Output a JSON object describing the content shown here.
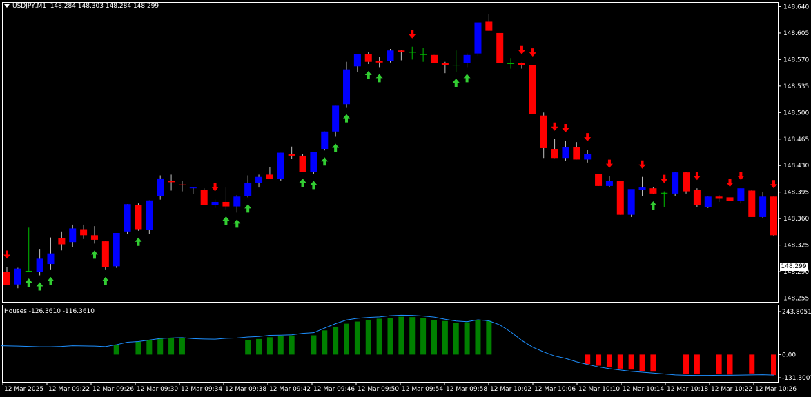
{
  "header": {
    "symbol_label": "USDJPY,M1",
    "ohlc": "148.284 148.303 148.284 148.299"
  },
  "indicator": {
    "label": "Houses -126.3610 -116.3610",
    "axis_labels": [
      "243.8051",
      "0.00",
      "-131.3007"
    ]
  },
  "current_price_label": "148.299",
  "price_axis_labels": [
    "148.640",
    "148.605",
    "148.570",
    "148.535",
    "148.500",
    "148.465",
    "148.430",
    "148.395",
    "148.360",
    "148.325",
    "148.290",
    "148.255"
  ],
  "time_axis_labels": [
    "12 Mar 2025",
    "12 Mar 09:22",
    "12 Mar 09:26",
    "12 Mar 09:30",
    "12 Mar 09:34",
    "12 Mar 09:38",
    "12 Mar 09:42",
    "12 Mar 09:46",
    "12 Mar 09:50",
    "12 Mar 09:54",
    "12 Mar 09:58",
    "12 Mar 10:02",
    "12 Mar 10:06",
    "12 Mar 10:10",
    "12 Mar 10:14",
    "12 Mar 10:18",
    "12 Mar 10:22",
    "12 Mar 10:26"
  ],
  "colors": {
    "background": "#000000",
    "bull_candle": "#0000ff",
    "bear_candle": "#ff0000",
    "doji": "#00c000",
    "wick": "#c0c0c0",
    "up_arrow": "#32cd32",
    "down_arrow": "#ff0000",
    "hist_positive": "#008000",
    "hist_negative": "#ff0000",
    "indicator_line": "#1e90ff",
    "zero_line": "#2f4f4f"
  },
  "chart_data": [
    {
      "type": "candlestick",
      "title": "USDJPY,M1",
      "ylim": [
        148.25,
        148.645
      ],
      "ohlc": [
        [
          148.29,
          148.296,
          148.272,
          148.272
        ],
        [
          148.273,
          148.295,
          148.268,
          148.294
        ],
        [
          148.291,
          148.348,
          148.29,
          148.291
        ],
        [
          148.29,
          148.32,
          148.285,
          148.307
        ],
        [
          148.3,
          148.335,
          148.292,
          148.314
        ],
        [
          148.334,
          148.343,
          148.318,
          148.326
        ],
        [
          148.329,
          148.352,
          148.322,
          148.347
        ],
        [
          148.346,
          148.352,
          148.333,
          148.338
        ],
        [
          148.338,
          148.35,
          148.327,
          148.332
        ],
        [
          148.33,
          148.33,
          148.292,
          148.296
        ],
        [
          148.297,
          148.341,
          148.295,
          148.341
        ],
        [
          148.343,
          148.379,
          148.34,
          148.379
        ],
        [
          148.378,
          148.38,
          148.344,
          148.346
        ],
        [
          148.345,
          148.384,
          148.34,
          148.384
        ],
        [
          148.39,
          148.417,
          148.385,
          148.413
        ],
        [
          148.41,
          148.418,
          148.397,
          148.408
        ],
        [
          148.405,
          148.41,
          148.396,
          148.404
        ],
        [
          148.4,
          148.402,
          148.392,
          148.401
        ],
        [
          148.398,
          148.4,
          148.378,
          148.378
        ],
        [
          148.378,
          148.385,
          148.374,
          148.382
        ],
        [
          148.382,
          148.401,
          148.372,
          148.376
        ],
        [
          148.376,
          148.391,
          148.368,
          148.389
        ],
        [
          148.39,
          148.417,
          148.388,
          148.407
        ],
        [
          148.407,
          148.418,
          148.401,
          148.415
        ],
        [
          148.418,
          148.428,
          148.412,
          148.412
        ],
        [
          148.412,
          148.447,
          148.41,
          148.447
        ],
        [
          148.445,
          148.455,
          148.439,
          148.443
        ],
        [
          148.443,
          148.445,
          148.422,
          148.422
        ],
        [
          148.422,
          148.448,
          148.419,
          148.448
        ],
        [
          148.452,
          148.475,
          148.45,
          148.475
        ],
        [
          148.475,
          148.509,
          148.468,
          148.509
        ],
        [
          148.511,
          148.567,
          148.507,
          148.557
        ],
        [
          148.561,
          148.577,
          148.554,
          148.577
        ],
        [
          148.577,
          148.58,
          148.564,
          148.567
        ],
        [
          148.568,
          148.574,
          148.56,
          148.566
        ],
        [
          148.568,
          148.584,
          148.566,
          148.582
        ],
        [
          148.582,
          148.583,
          148.569,
          148.58
        ],
        [
          148.58,
          148.587,
          148.57,
          148.58
        ],
        [
          148.577,
          148.585,
          148.567,
          148.577
        ],
        [
          148.576,
          148.576,
          148.565,
          148.565
        ],
        [
          148.565,
          148.567,
          148.552,
          148.563
        ],
        [
          148.563,
          148.582,
          148.554,
          148.563
        ],
        [
          148.565,
          148.578,
          148.56,
          148.576
        ],
        [
          148.578,
          148.619,
          148.575,
          148.619
        ],
        [
          148.62,
          148.63,
          148.608,
          148.608
        ],
        [
          148.605,
          148.605,
          148.565,
          148.565
        ],
        [
          148.565,
          148.572,
          148.558,
          148.565
        ],
        [
          148.565,
          148.566,
          148.558,
          148.563
        ],
        [
          148.563,
          148.563,
          148.498,
          148.498
        ],
        [
          148.496,
          148.5,
          148.44,
          148.453
        ],
        [
          148.452,
          148.465,
          148.44,
          148.44
        ],
        [
          148.44,
          148.463,
          148.436,
          148.454
        ],
        [
          148.454,
          148.461,
          148.438,
          148.438
        ],
        [
          148.438,
          148.451,
          148.434,
          148.445
        ],
        [
          148.419,
          148.419,
          148.403,
          148.403
        ],
        [
          148.403,
          148.416,
          148.402,
          148.41
        ],
        [
          148.41,
          148.41,
          148.365,
          148.365
        ],
        [
          148.365,
          148.398,
          148.362,
          148.399
        ],
        [
          148.398,
          148.415,
          148.39,
          148.401
        ],
        [
          148.4,
          148.401,
          148.392,
          148.393
        ],
        [
          148.394,
          148.396,
          148.375,
          148.394
        ],
        [
          148.393,
          148.421,
          148.39,
          148.421
        ],
        [
          148.421,
          148.422,
          148.393,
          148.396
        ],
        [
          148.398,
          148.4,
          148.375,
          148.378
        ],
        [
          148.375,
          148.389,
          148.374,
          148.389
        ],
        [
          148.389,
          148.391,
          148.382,
          148.387
        ],
        [
          148.388,
          148.391,
          148.382,
          148.383
        ],
        [
          148.383,
          148.4,
          148.38,
          148.4
        ],
        [
          148.397,
          148.398,
          148.362,
          148.362
        ],
        [
          148.362,
          148.395,
          148.361,
          148.389
        ],
        [
          148.389,
          148.389,
          148.337,
          148.338
        ]
      ],
      "up_arrow_bars": [
        2,
        3,
        4,
        8,
        9,
        12,
        20,
        21,
        22,
        27,
        28,
        29,
        30,
        31,
        33,
        34,
        41,
        42,
        59
      ],
      "down_arrow_bars": [
        0,
        19,
        37,
        47,
        48,
        50,
        51,
        53,
        55,
        58,
        60,
        63,
        66,
        67,
        70
      ]
    },
    {
      "type": "bar",
      "title": "Houses -126.3610 -116.3610",
      "ylim": [
        -131.3007,
        243.8051
      ],
      "values": [
        0,
        0,
        0,
        0,
        0,
        0,
        0,
        0,
        0,
        0,
        56,
        0,
        72,
        80,
        89,
        92,
        95,
        0,
        0,
        0,
        0,
        0,
        81,
        88,
        98,
        107,
        108,
        0,
        109,
        137,
        158,
        175,
        187,
        197,
        203,
        207,
        214,
        212,
        206,
        195,
        190,
        180,
        183,
        197,
        190,
        0,
        0,
        0,
        0,
        0,
        0,
        0,
        0,
        -54,
        -63,
        -73,
        -80,
        -85,
        -93,
        -97,
        0,
        0,
        -108,
        -112,
        0,
        -109,
        -113,
        0,
        -107,
        0,
        -116
      ],
      "line": [
        50,
        48,
        46,
        44,
        44,
        46,
        50,
        49,
        48,
        45,
        56,
        70,
        74,
        82,
        91,
        94,
        96,
        90,
        88,
        87,
        92,
        94,
        99,
        102,
        109,
        110,
        112,
        120,
        124,
        150,
        175,
        196,
        205,
        210,
        213,
        220,
        223,
        222,
        218,
        212,
        200,
        190,
        186,
        197,
        191,
        168,
        128,
        80,
        42,
        15,
        -8,
        -22,
        -41,
        -56,
        -70,
        -80,
        -88,
        -95,
        -100,
        -105,
        -110,
        -115,
        -117,
        -118,
        -118,
        -117,
        -117,
        -116,
        -115,
        -114,
        -116
      ]
    }
  ]
}
